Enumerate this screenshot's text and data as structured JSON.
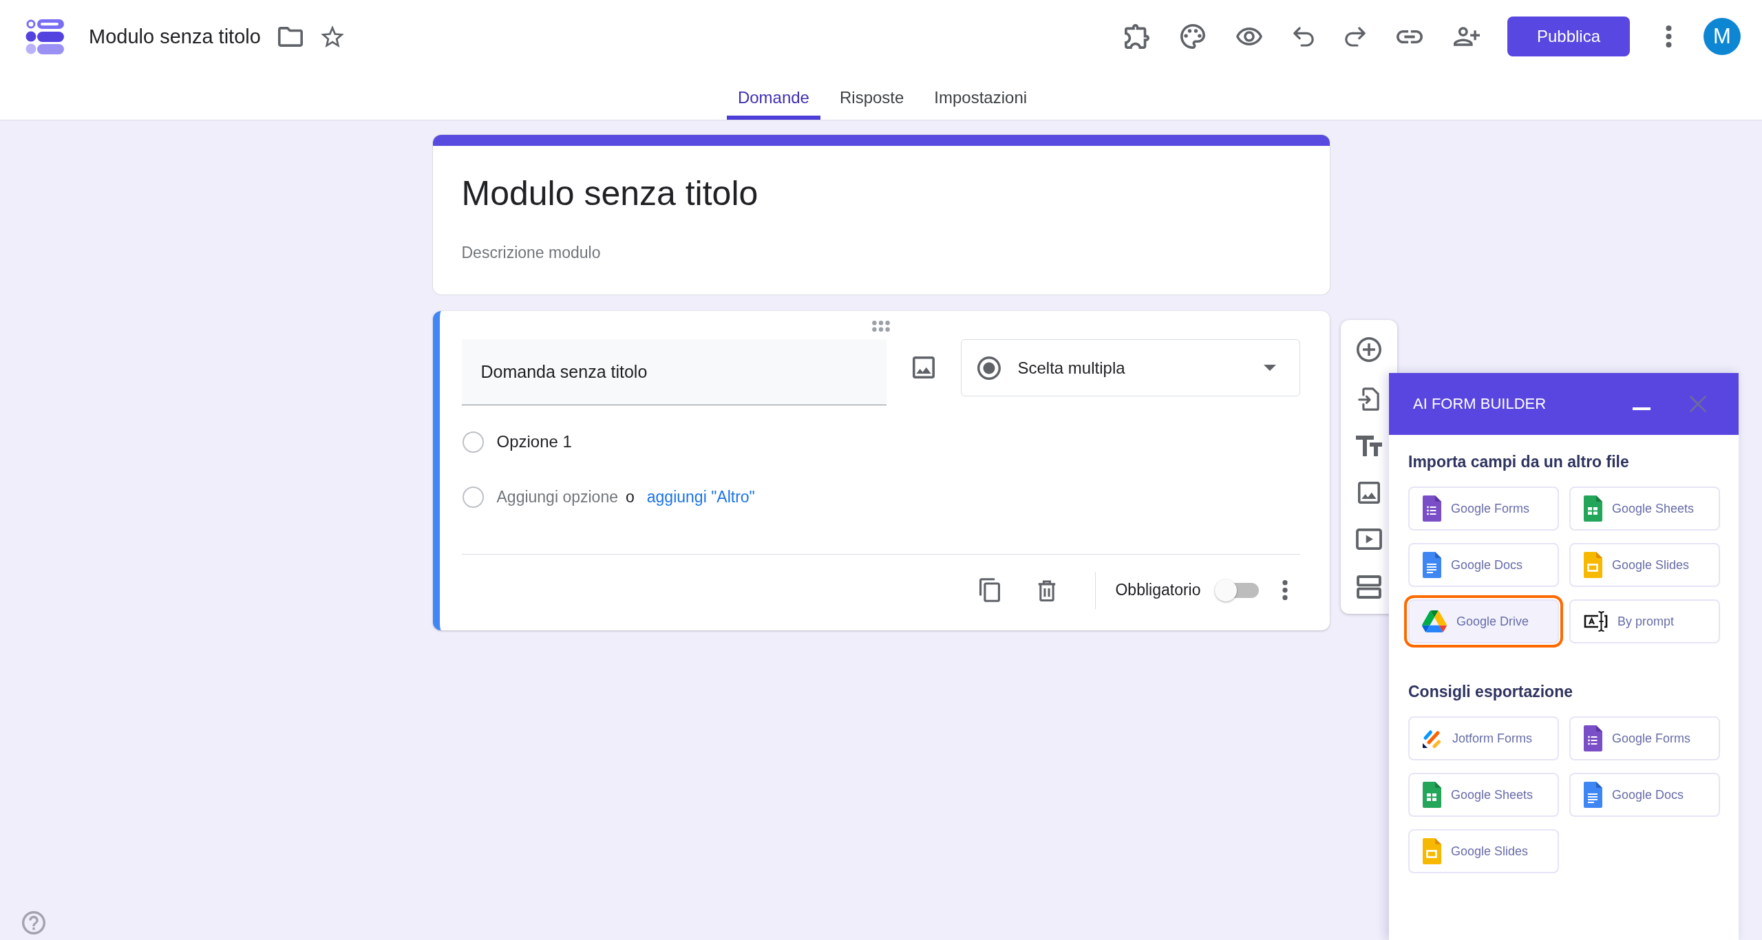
{
  "app_bar": {
    "title": "Modulo senza titolo",
    "publish_button": "Pubblica",
    "avatar_initial": "M"
  },
  "tabs": [
    {
      "label": "Domande",
      "selected": true
    },
    {
      "label": "Risposte",
      "selected": false
    },
    {
      "label": "Impostazioni",
      "selected": false
    }
  ],
  "form_header": {
    "title": "Modulo senza titolo",
    "description": {
      "placeholder": "Descrizione modulo"
    }
  },
  "question": {
    "title": "Domanda senza titolo",
    "type": "Scelta multipla",
    "options": [
      {
        "label": "Opzione 1"
      }
    ],
    "add_option": "Aggiungi opzione",
    "separator": "o",
    "add_other_link": "aggiungi \"Altro\"",
    "required": {
      "label": "Obbligatorio",
      "on": false
    }
  },
  "ai_form_builder": {
    "title": "AI FORM BUILDER",
    "sections": [
      {
        "heading": "Importa campi da un altro file",
        "items": [
          {
            "label": "Google Forms",
            "kind": "forms",
            "highlighted": false
          },
          {
            "label": "Google Sheets",
            "kind": "sheets",
            "highlighted": false
          },
          {
            "label": "Google Docs",
            "kind": "docs",
            "highlighted": false
          },
          {
            "label": "Google Slides",
            "kind": "slides",
            "highlighted": false
          },
          {
            "label": "Google Drive",
            "kind": "drive",
            "highlighted": true
          },
          {
            "label": "By prompt",
            "kind": "prompt",
            "highlighted": false
          }
        ]
      },
      {
        "heading": "Consigli esportazione",
        "items": [
          {
            "label": "Jotform Forms",
            "kind": "jotform",
            "highlighted": false
          },
          {
            "label": "Google Forms",
            "kind": "forms",
            "highlighted": false
          },
          {
            "label": "Google Sheets",
            "kind": "sheets",
            "highlighted": false
          },
          {
            "label": "Google Docs",
            "kind": "docs",
            "highlighted": false
          },
          {
            "label": "Google Slides",
            "kind": "slides",
            "highlighted": false
          }
        ]
      }
    ]
  }
}
